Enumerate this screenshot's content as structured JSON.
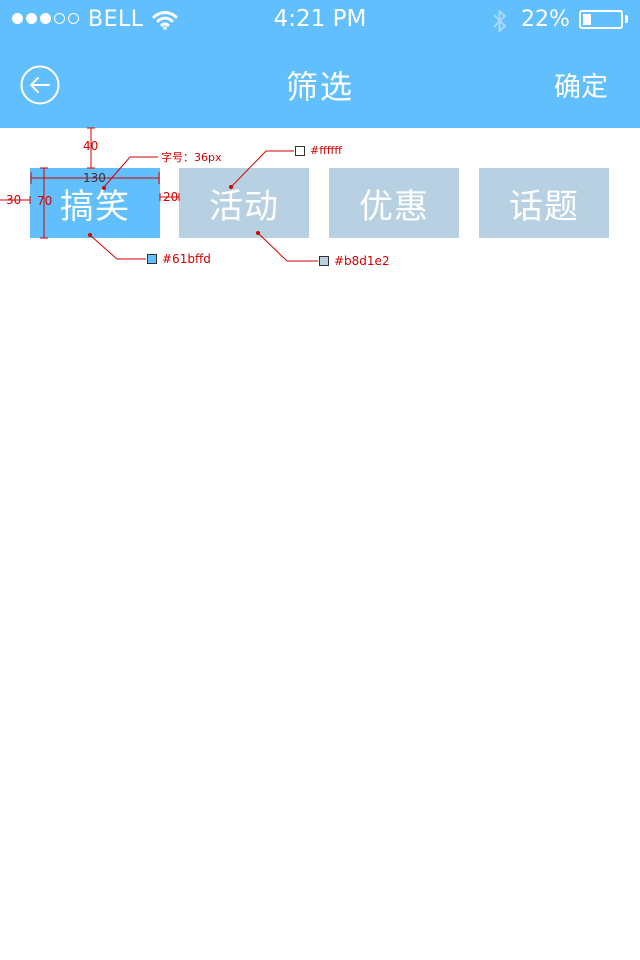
{
  "status_bar": {
    "signal_dots_filled": 3,
    "signal_dots_total": 5,
    "carrier": "BELL",
    "time": "4:21 PM",
    "battery_percent": "22%",
    "battery_level": 0.22,
    "icons": [
      "wifi-icon",
      "bluetooth-icon",
      "battery-icon"
    ]
  },
  "nav": {
    "back_icon": "back-arrow-icon",
    "title": "筛选",
    "confirm_label": "确定"
  },
  "categories": [
    {
      "label": "搞笑",
      "active": true
    },
    {
      "label": "活动",
      "active": false
    },
    {
      "label": "优惠",
      "active": false
    },
    {
      "label": "话题",
      "active": false
    }
  ],
  "annotations": {
    "top_margin": "40",
    "chip_width": "130",
    "chip_height": "70",
    "left_margin": "30",
    "chip_gap": "20",
    "font_size_note": "字号：36px",
    "text_color_note": "#ffffff",
    "active_color_note": "#61bffd",
    "inactive_color_note": "#b8d1e2"
  },
  "colors": {
    "accent": "#61bffd",
    "inactive": "#b8d1e2",
    "text_on_chip": "#ffffff",
    "annotation": "#d40000"
  }
}
